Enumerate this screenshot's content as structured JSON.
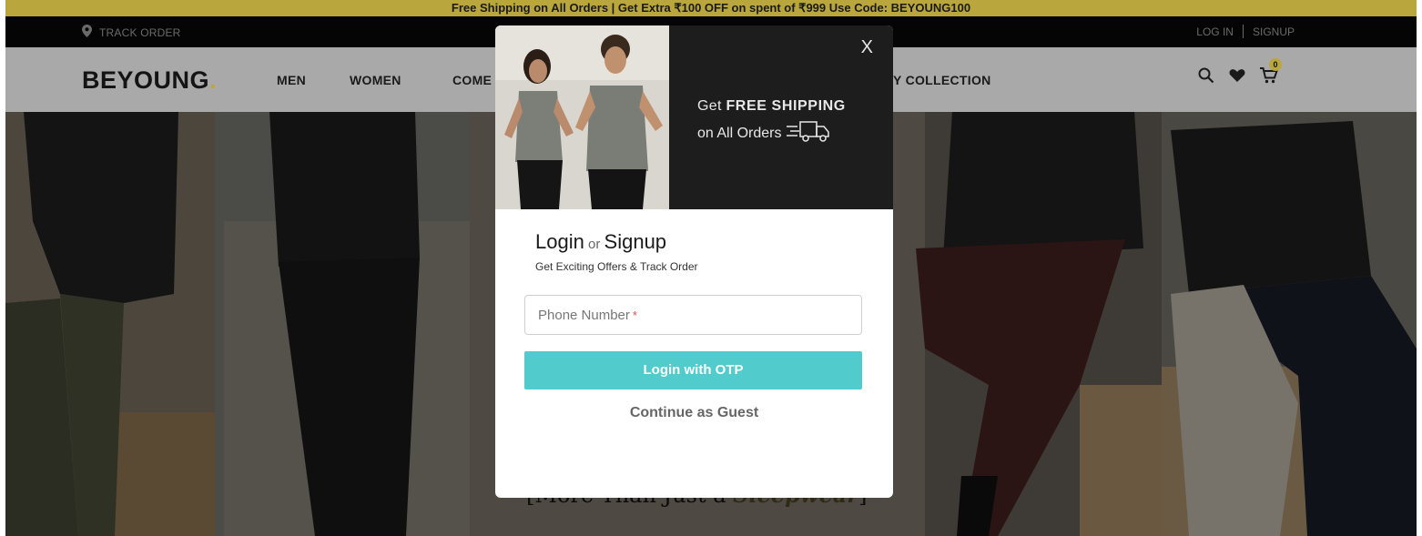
{
  "promo": {
    "text": "Free Shipping on All Orders | Get Extra ₹100 OFF on spent of ₹999 Use Code: BEYOUNG100"
  },
  "topbar": {
    "track_label": "TRACK ORDER",
    "track_icon": "map-pin-icon",
    "login_label": "LOG IN",
    "signup_label": "SIGNUP"
  },
  "nav": {
    "logo_text": "BEYOUNG",
    "logo_dot": ".",
    "links": [
      "MEN",
      "WOMEN",
      "COME",
      "Y COLLECTION"
    ],
    "icons": [
      "search-icon",
      "heart-icon",
      "cart-icon"
    ],
    "cart_count": "0"
  },
  "hero": {
    "caption_start": "[More Than Just a ",
    "caption_bold": "Sleepwear",
    "caption_end": "]"
  },
  "modal": {
    "close_label": "X",
    "banner": {
      "line1_prefix": "Get ",
      "line1_bold": "FREE SHIPPING",
      "line2": "on All Orders"
    },
    "title_login": "Login",
    "title_or": " or ",
    "title_signup": "Signup",
    "subtitle": "Get Exciting Offers & Track Order",
    "phone_placeholder": "Phone Number",
    "phone_required_mark": "*",
    "otp_button": "Login with OTP",
    "guest_link": "Continue as Guest"
  },
  "colors": {
    "accent_gold": "#b9a73d",
    "otp_teal": "#51cbcb",
    "overlay_dark": "#2b2b2b"
  }
}
